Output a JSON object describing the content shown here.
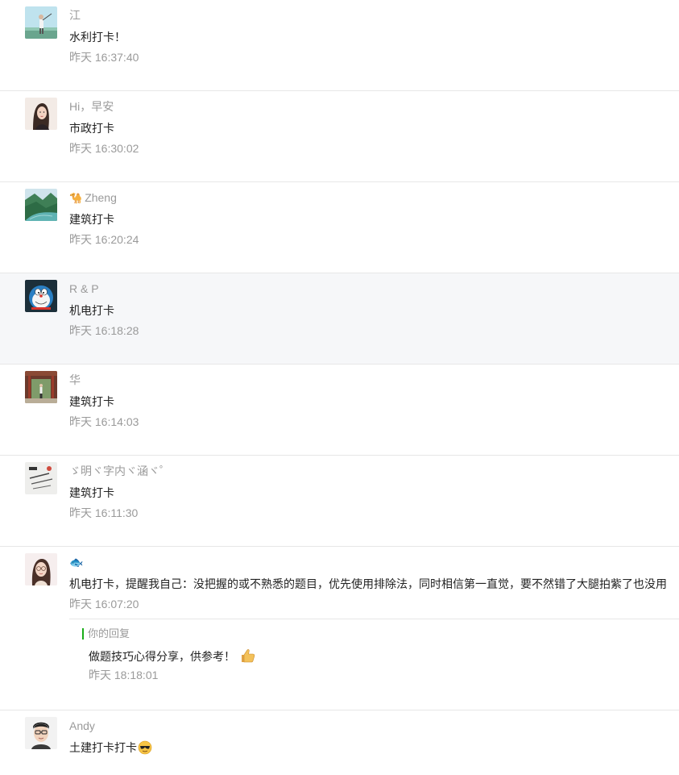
{
  "comments": [
    {
      "nickname": "江",
      "text": "水利打卡！",
      "time": "昨天 16:37:40",
      "avatar_icon": "golfer-avatar"
    },
    {
      "nickname": "Hi，早安",
      "text": "市政打卡",
      "time": "昨天 16:30:02",
      "avatar_icon": "woman-portrait-avatar"
    },
    {
      "nickname_emoji": "🐪",
      "nickname": "Zheng",
      "text": "建筑打卡",
      "time": "昨天 16:20:24",
      "avatar_icon": "landscape-river-avatar"
    },
    {
      "nickname": "R & P",
      "text": "机电打卡",
      "time": "昨天 16:18:28",
      "avatar_icon": "cartoon-cat-avatar"
    },
    {
      "nickname": "华",
      "text": "建筑打卡",
      "time": "昨天 16:14:03",
      "avatar_icon": "garden-corridor-avatar"
    },
    {
      "nickname": "ゞ明ヾ字内ヾ涵ヾ゜",
      "text": "建筑打卡",
      "time": "昨天 16:11:30",
      "avatar_icon": "stationery-avatar"
    },
    {
      "nickname": "🐟",
      "text": "机电打卡，提醒我自己：没把握的或不熟悉的题目，优先使用排除法，同时相信第一直觉，要不然错了大腿拍紫了也没用",
      "time": "昨天 16:07:20",
      "avatar_icon": "glasses-woman-avatar",
      "reply": {
        "label": "你的回复",
        "text": "做题技巧心得分享，供参考！",
        "emoji_icon": "thumbs-up-icon",
        "time": "昨天 18:18:01"
      }
    },
    {
      "nickname": "Andy",
      "text": "土建打卡打卡",
      "text_emoji_icon": "sunglasses-face-icon",
      "avatar_icon": "man-glasses-avatar"
    }
  ],
  "colors": {
    "muted_text": "#9a9a9a",
    "body_text": "#222222",
    "divider": "#e7e7e7",
    "hover_row": "#f6f7f9",
    "reply_accent": "#1aad19"
  }
}
